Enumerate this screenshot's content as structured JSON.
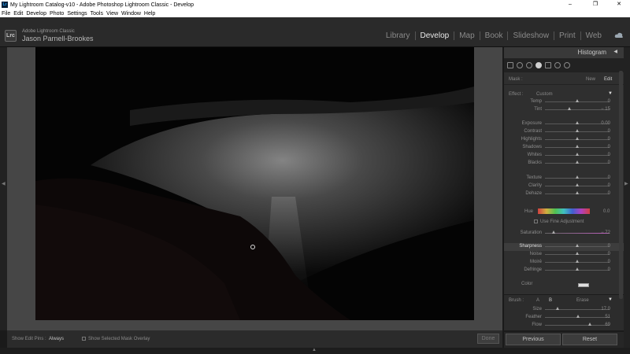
{
  "window": {
    "title": "My Lightroom Catalog-v10 - Adobe Photoshop Lightroom Classic - Develop",
    "icon": "Lr",
    "minimize": "–",
    "maximize": "❐",
    "close": "✕"
  },
  "menu": [
    "File",
    "Edit",
    "Develop",
    "Photo",
    "Settings",
    "Tools",
    "View",
    "Window",
    "Help"
  ],
  "brand": {
    "logo": "Lrc",
    "product": "Adobe Lightroom Classic",
    "user": "Jason Parnell-Brookes"
  },
  "modules": [
    "Library",
    "Develop",
    "Map",
    "Book",
    "Slideshow",
    "Print",
    "Web"
  ],
  "active_module": "Develop",
  "toolbar": {
    "show_edit_pins_label": "Show Edit Pins :",
    "show_edit_pins_value": "Always",
    "show_overlay_label": "Show Selected Mask Overlay",
    "done_label": "Done"
  },
  "panel": {
    "title": "Histogram",
    "collapse": "◀",
    "mask_label": "Mask :",
    "mask_new": "New",
    "mask_edit": "Edit",
    "effect_label": "Effect :",
    "effect_value": "Custom",
    "effect_arrow": "▼",
    "hue_label": "Hue",
    "hue_value": "0.0",
    "fine_adjust_label": "Use Fine Adjustment",
    "color_label": "Color",
    "brush_label": "Brush :",
    "brush_a": "A",
    "brush_b": "B",
    "brush_erase": "Erase",
    "brush_arrow": "▼",
    "sliders": [
      {
        "name": "Temp",
        "value": "0"
      },
      {
        "name": "Tint",
        "value": "− 15"
      },
      {
        "name": "Exposure",
        "value": "0.00"
      },
      {
        "name": "Contrast",
        "value": "0"
      },
      {
        "name": "Highlights",
        "value": "0"
      },
      {
        "name": "Shadows",
        "value": "0"
      },
      {
        "name": "Whites",
        "value": "0"
      },
      {
        "name": "Blacks",
        "value": "0"
      },
      {
        "name": "Texture",
        "value": "0"
      },
      {
        "name": "Clarity",
        "value": "0"
      },
      {
        "name": "Dehaze",
        "value": "0"
      },
      {
        "name": "Saturation",
        "value": "− 72"
      },
      {
        "name": "Sharpness",
        "value": "0"
      },
      {
        "name": "Noise",
        "value": "0"
      },
      {
        "name": "Moiré",
        "value": "0"
      },
      {
        "name": "Defringe",
        "value": "0"
      }
    ],
    "brush_sliders": [
      {
        "name": "Size",
        "value": "17.0"
      },
      {
        "name": "Feather",
        "value": "51"
      },
      {
        "name": "Flow",
        "value": "69"
      }
    ]
  },
  "buttons": {
    "previous": "Previous",
    "reset": "Reset"
  },
  "colors": {
    "panel_bg": "#2f2f2f",
    "accent_text": "#e8e8e8"
  }
}
